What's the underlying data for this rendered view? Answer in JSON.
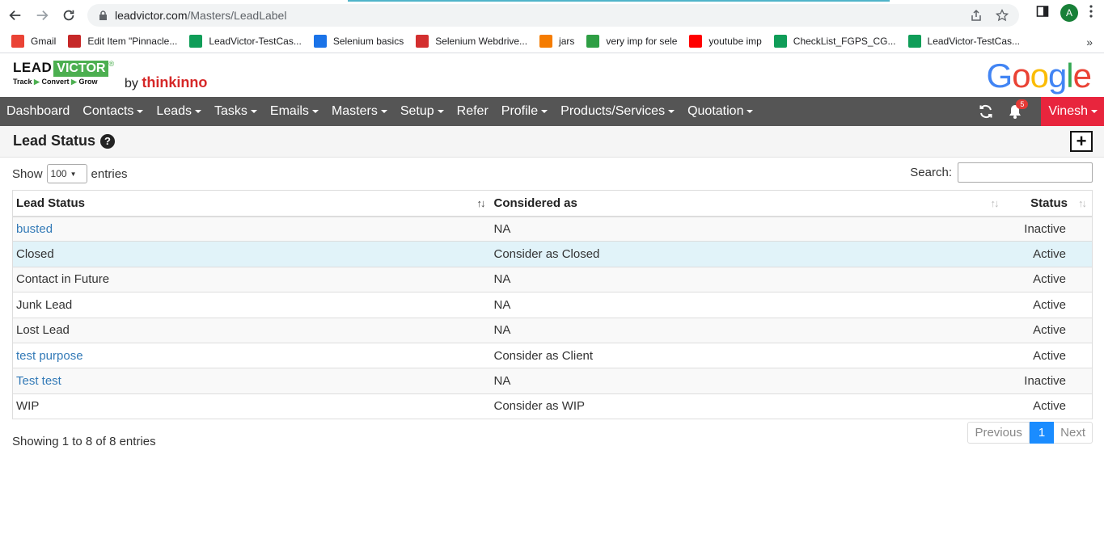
{
  "browser": {
    "url_host": "leadvictor.com",
    "url_path": "/Masters/LeadLabel",
    "profile_initial": "A",
    "bookmarks": [
      {
        "label": "Gmail",
        "icon": "gmail-icon",
        "color": "#ea4335"
      },
      {
        "label": "Edit Item \"Pinnacle...",
        "icon": "edit-icon",
        "color": "#c62828"
      },
      {
        "label": "LeadVictor-TestCas...",
        "icon": "sheets-icon",
        "color": "#0f9d58"
      },
      {
        "label": "Selenium basics",
        "icon": "selenium-icon",
        "color": "#1a73e8"
      },
      {
        "label": "Selenium Webdrive...",
        "icon": "tricentis-icon",
        "color": "#d32f2f"
      },
      {
        "label": "jars",
        "icon": "blogger-icon",
        "color": "#f57c00"
      },
      {
        "label": "very imp for sele",
        "icon": "s-icon",
        "color": "#2e9e44"
      },
      {
        "label": "youtube imp",
        "icon": "youtube-icon",
        "color": "#ff0000"
      },
      {
        "label": "CheckList_FGPS_CG...",
        "icon": "sheets-icon",
        "color": "#0f9d58"
      },
      {
        "label": "LeadVictor-TestCas...",
        "icon": "sheets-icon",
        "color": "#0f9d58"
      }
    ],
    "more": "»"
  },
  "header": {
    "logo_lead": "LEAD",
    "logo_victor": "VICTOR",
    "logo_reg": "®",
    "logo_tagline": [
      "Track",
      "Convert",
      "Grow"
    ],
    "by": "by",
    "by_brand": "thinkinno",
    "google": "Google"
  },
  "nav": {
    "items": [
      {
        "label": "Dashboard",
        "caret": false
      },
      {
        "label": "Contacts",
        "caret": true
      },
      {
        "label": "Leads",
        "caret": true
      },
      {
        "label": "Tasks",
        "caret": true
      },
      {
        "label": "Emails",
        "caret": true
      },
      {
        "label": "Masters",
        "caret": true
      },
      {
        "label": "Setup",
        "caret": true
      },
      {
        "label": "Refer",
        "caret": false
      },
      {
        "label": "Profile",
        "caret": true
      },
      {
        "label": "Products/Services",
        "caret": true
      },
      {
        "label": "Quotation",
        "caret": true
      }
    ],
    "notification_count": "5",
    "user": "Vinesh"
  },
  "page": {
    "title": "Lead Status",
    "help": "?",
    "add": "+"
  },
  "controls": {
    "show_label": "Show",
    "page_size": "100",
    "entries_label": "entries",
    "search_label": "Search:",
    "search_value": ""
  },
  "table": {
    "headers": [
      "Lead Status",
      "Considered as",
      "Status"
    ],
    "rows": [
      {
        "lead_status": "busted",
        "considered_as": "NA",
        "status": "Inactive",
        "link": true
      },
      {
        "lead_status": "Closed",
        "considered_as": "Consider as Closed",
        "status": "Active",
        "link": false
      },
      {
        "lead_status": "Contact in Future",
        "considered_as": "NA",
        "status": "Active",
        "link": false
      },
      {
        "lead_status": "Junk Lead",
        "considered_as": "NA",
        "status": "Active",
        "link": false
      },
      {
        "lead_status": "Lost Lead",
        "considered_as": "NA",
        "status": "Active",
        "link": false
      },
      {
        "lead_status": "test purpose",
        "considered_as": "Consider as Client",
        "status": "Active",
        "link": true
      },
      {
        "lead_status": "Test test",
        "considered_as": "NA",
        "status": "Inactive",
        "link": true
      },
      {
        "lead_status": "WIP",
        "considered_as": "Consider as WIP",
        "status": "Active",
        "link": false
      }
    ]
  },
  "footer": {
    "info": "Showing 1 to 8 of 8 entries",
    "previous": "Previous",
    "current_page": "1",
    "next": "Next"
  }
}
